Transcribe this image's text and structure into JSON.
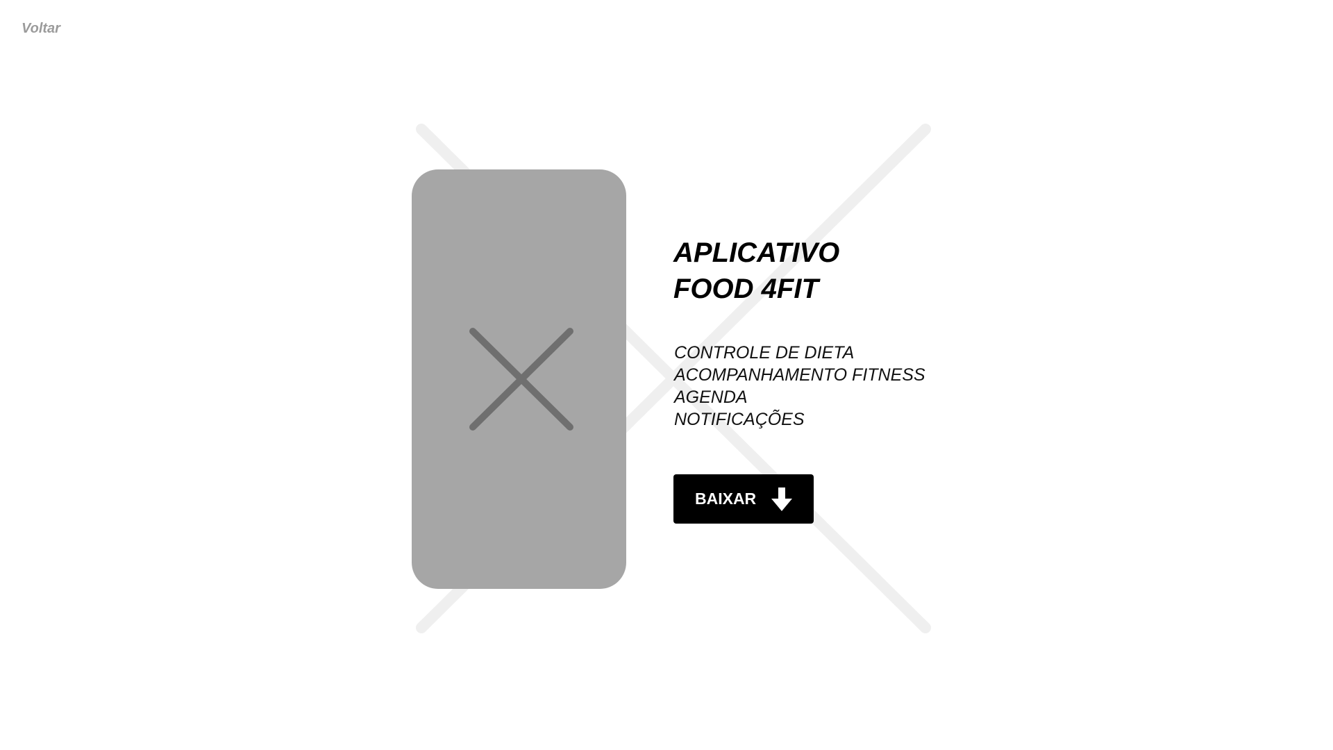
{
  "nav": {
    "back_label": "Voltar"
  },
  "hero": {
    "title_line1": "APLICATIVO",
    "title_line2": "FOOD 4FIT",
    "features": [
      "CONTROLE DE DIETA",
      "ACOMPANHAMENTO FITNESS",
      "AGENDA",
      "NOTIFICAÇÕES"
    ],
    "download_label": "BAIXAR",
    "download_icon": "arrow-down-icon",
    "image_icon": "image-placeholder-icon"
  },
  "colors": {
    "background": "#ffffff",
    "placeholder": "#a3a3a3",
    "placeholder_cross": "#6f6f6f",
    "background_cross": "#efefef",
    "button": "#000000",
    "button_text": "#ffffff",
    "back_link": "#9b9b9b"
  }
}
